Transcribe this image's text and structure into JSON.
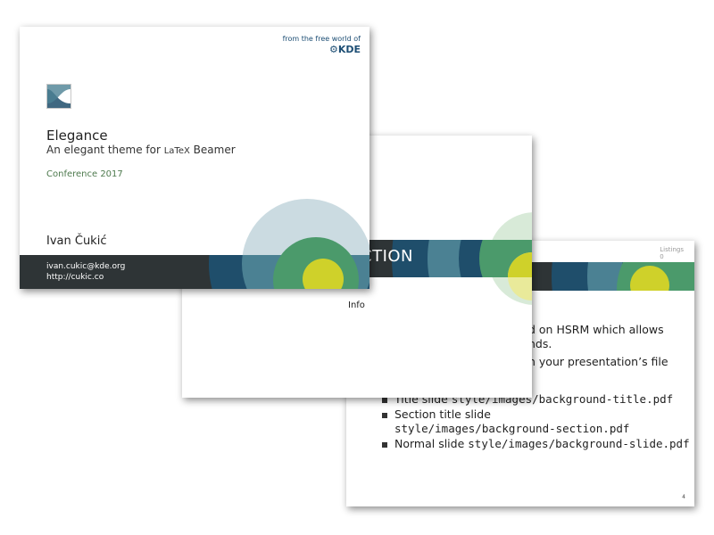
{
  "colors": {
    "dark": "#2e3436",
    "navy": "#1f4e6b",
    "teal": "#4b8193",
    "pale_blue": "#cbdbe1",
    "green": "#4b9a6b",
    "light_green": "#74b684",
    "yellow": "#cfd12a",
    "kde_blue": "#1d4e74"
  },
  "title_slide": {
    "kde_line1": "from the free world of",
    "kde_line2": "KDE",
    "logo_icon": "elegance-wave-icon",
    "title": "Elegance",
    "subtitle_prefix": "An elegant theme for ",
    "subtitle_latex": "LaTeX",
    "subtitle_suffix": " Beamer",
    "conference": "Conference 2017",
    "author": "Ivan Čukić",
    "email": "ivan.cukic@kde.org",
    "url": "http://cukic.co"
  },
  "section_slide": {
    "section_title": "CTION",
    "info": "Info"
  },
  "normal_slide": {
    "corner_label_1": "Listings",
    "corner_label_2": "0",
    "line1": "d on HSRM which allows",
    "line2": "nds.",
    "line3": "n your presentation’s file",
    "bullets": [
      {
        "label": "Title slide ",
        "path": "style/images/background-title.pdf"
      },
      {
        "label": "Section title slide",
        "path": "style/images/background-section.pdf"
      },
      {
        "label": "Normal slide ",
        "path": "style/images/background-slide.pdf"
      }
    ],
    "page_number": "4"
  }
}
